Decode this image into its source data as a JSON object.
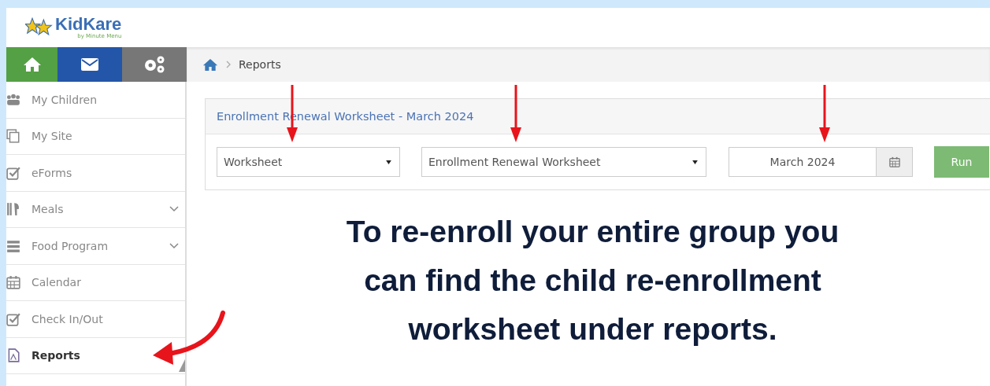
{
  "logo": {
    "name": "KidKare",
    "tagline": "by Minute Menu"
  },
  "breadcrumb": [
    "Reports"
  ],
  "sidebar": {
    "items": [
      {
        "label": "My Children",
        "expandable": false,
        "selected": false
      },
      {
        "label": "My Site",
        "expandable": false,
        "selected": false
      },
      {
        "label": "eForms",
        "expandable": false,
        "selected": false
      },
      {
        "label": "Meals",
        "expandable": true,
        "selected": false
      },
      {
        "label": "Food Program",
        "expandable": true,
        "selected": false
      },
      {
        "label": "Calendar",
        "expandable": false,
        "selected": false
      },
      {
        "label": "Check In/Out",
        "expandable": false,
        "selected": false
      },
      {
        "label": "Reports",
        "expandable": false,
        "selected": true
      }
    ]
  },
  "report_panel": {
    "title": "Enrollment Renewal Worksheet - March 2024",
    "selects": [
      {
        "value": "Worksheet"
      },
      {
        "value": "Enrollment Renewal Worksheet"
      }
    ],
    "date_field": {
      "value": "March 2024"
    },
    "run_button": "Run"
  },
  "annotation": "To re-enroll your entire group you can find the child re-enrollment worksheet under reports."
}
